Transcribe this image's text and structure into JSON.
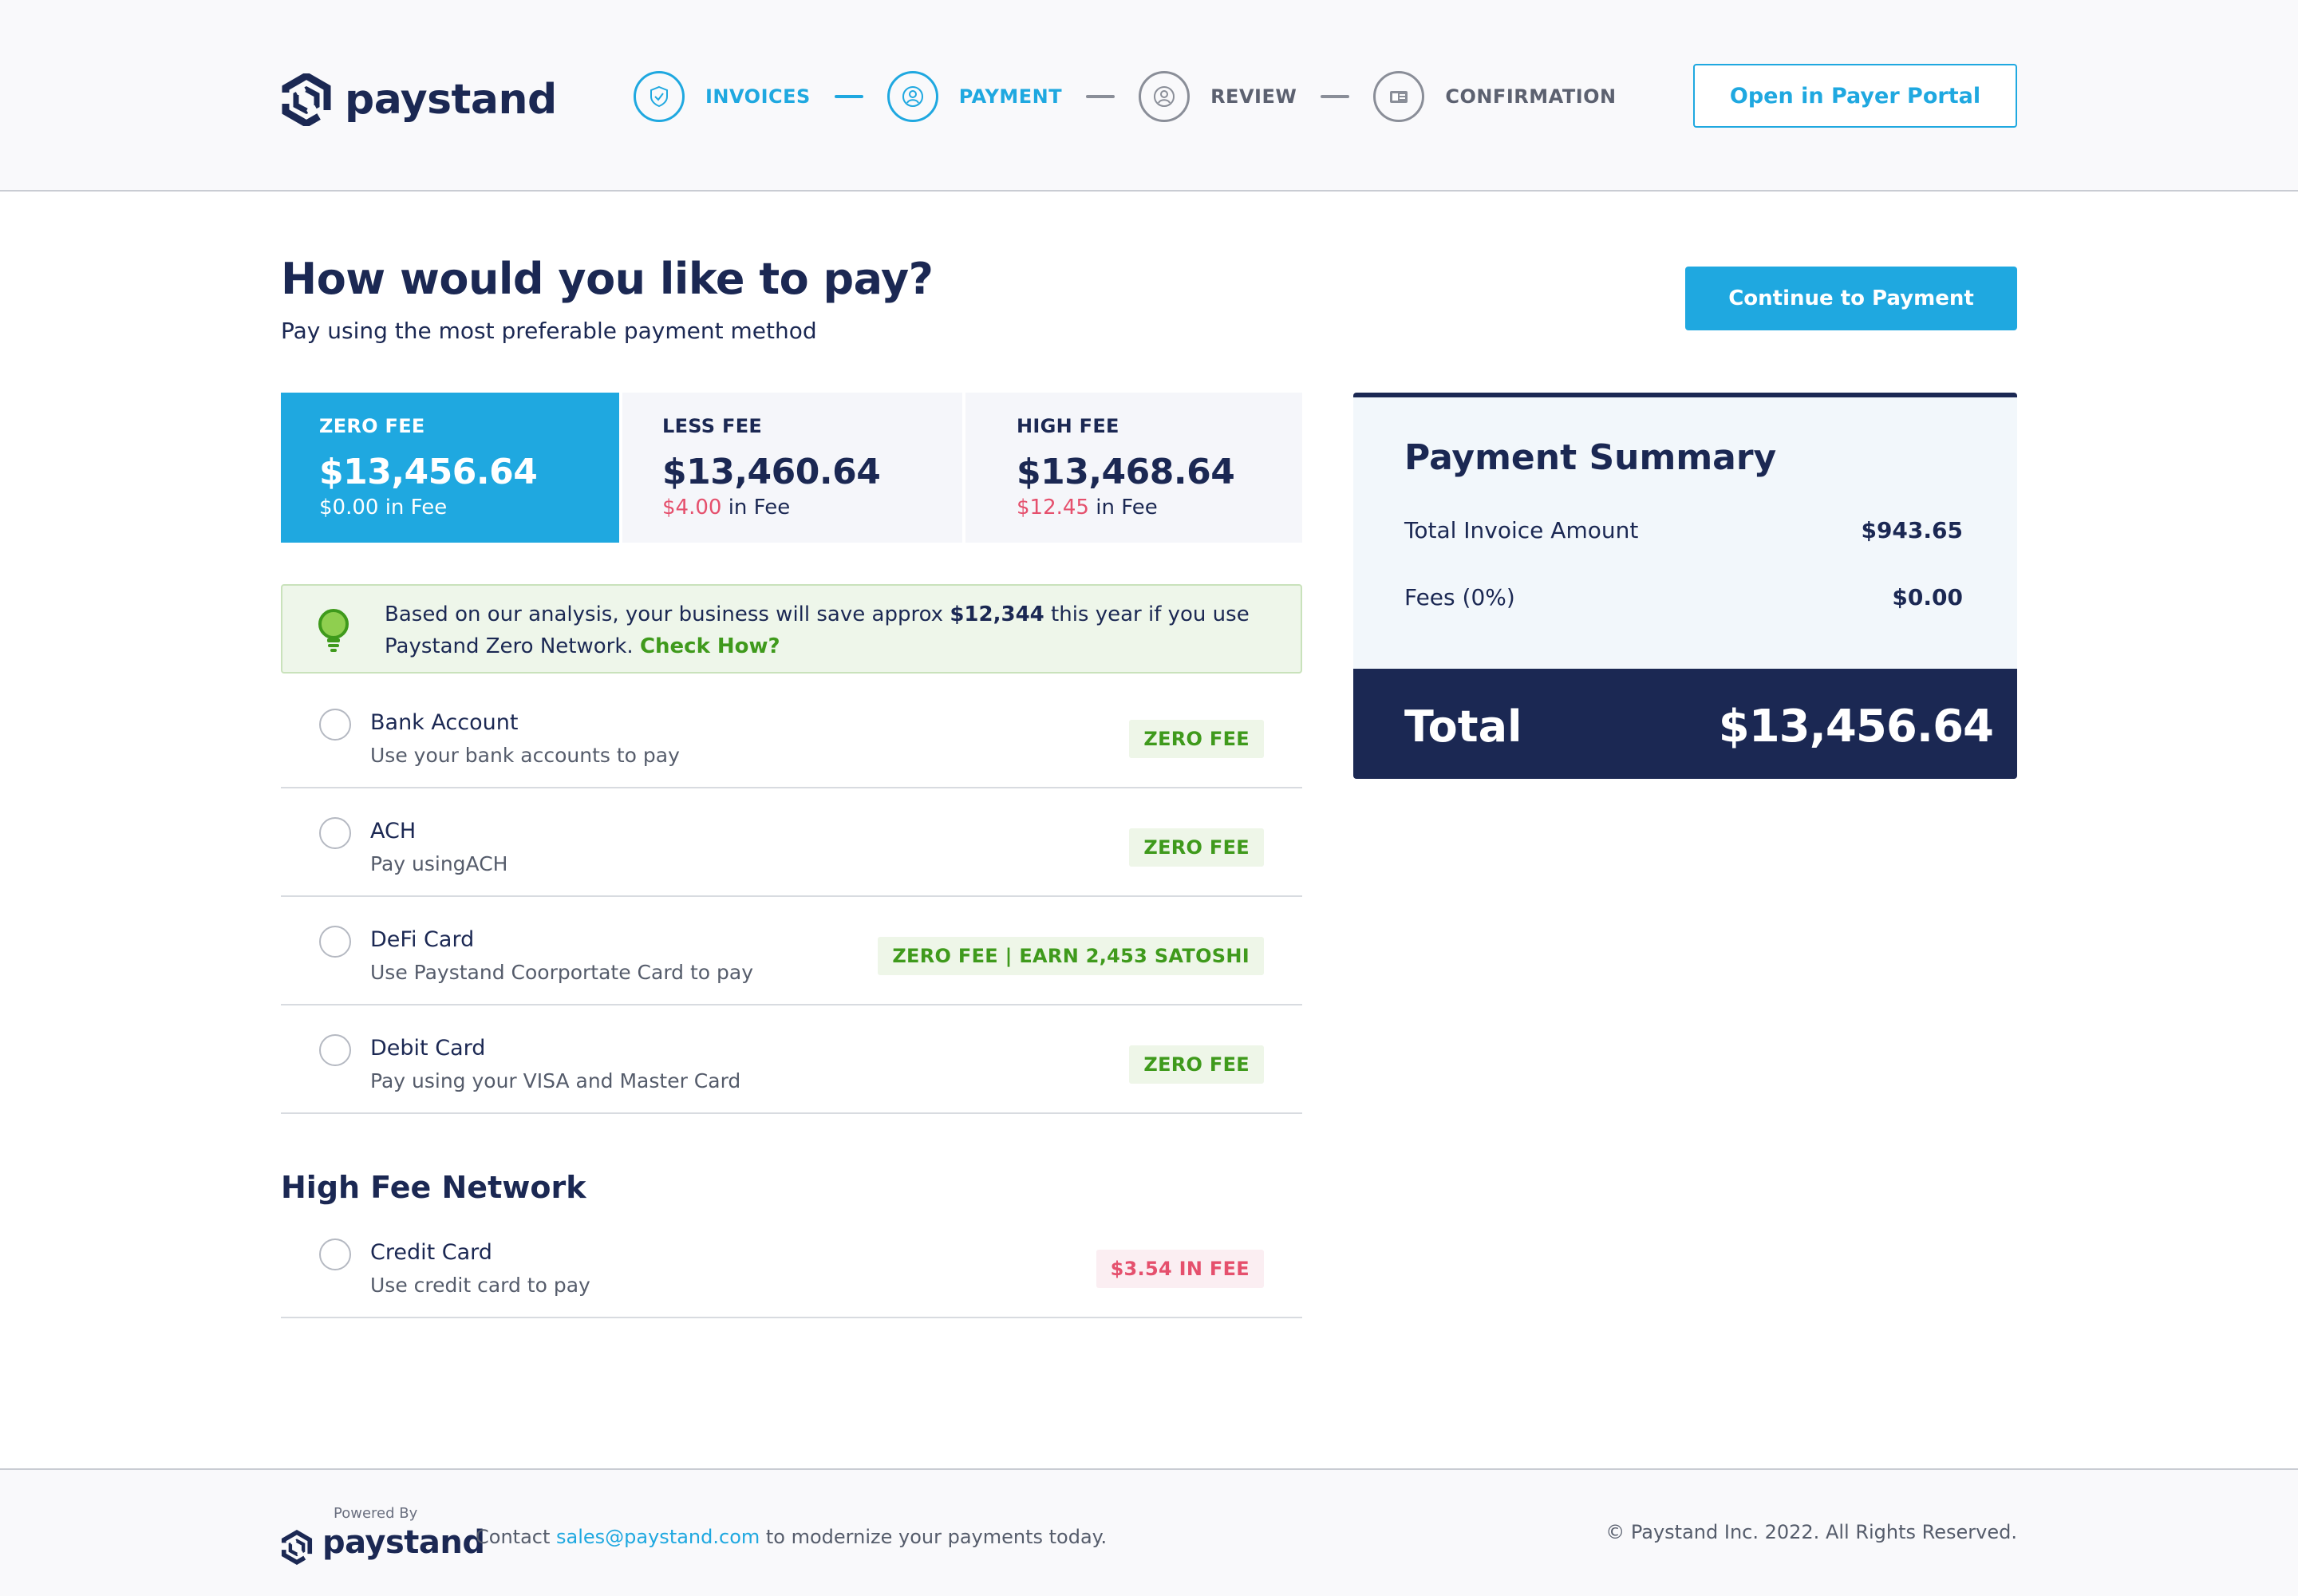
{
  "header": {
    "brand": "paystand",
    "steps": [
      {
        "label": "INVOICES"
      },
      {
        "label": "PAYMENT"
      },
      {
        "label": "REVIEW"
      },
      {
        "label": "CONFIRMATION"
      }
    ],
    "portal_button": "Open in Payer Portal"
  },
  "main": {
    "title": "How would you like to pay?",
    "subtitle": "Pay using the most preferable payment method",
    "continue_button": "Continue to Payment",
    "fee_tabs": [
      {
        "label": "ZERO FEE",
        "amount": "$13,456.64",
        "fee": "$0.00",
        "fee_suffix": " in Fee"
      },
      {
        "label": "LESS FEE",
        "amount": "$13,460.64",
        "fee": "$4.00",
        "fee_suffix": " in Fee"
      },
      {
        "label": "HIGH FEE",
        "amount": "$13,468.64",
        "fee": "$12.45",
        "fee_suffix": " in Fee"
      }
    ],
    "insight": {
      "prefix": "Based on our analysis, your business will save approx ",
      "amount": "$12,344",
      "middle": " this year if you use Paystand Zero Network. ",
      "link": "Check How?"
    },
    "methods": [
      {
        "name": "Bank Account",
        "desc": "Use your bank accounts to pay",
        "badge": "ZERO FEE"
      },
      {
        "name": "ACH",
        "desc": "Pay usingACH",
        "badge": "ZERO FEE"
      },
      {
        "name": "DeFi Card",
        "desc": "Use Paystand Coorportate Card to pay",
        "badge": "ZERO FEE | EARN 2,453 SATOSHI"
      },
      {
        "name": "Debit Card",
        "desc": "Pay using your VISA and Master Card",
        "badge": "ZERO FEE"
      }
    ],
    "high_fee_network": {
      "title": "High Fee Network",
      "methods": [
        {
          "name": "Credit Card",
          "desc": "Use credit card to pay",
          "badge": "$3.54 IN FEE"
        }
      ]
    }
  },
  "summary": {
    "title": "Payment Summary",
    "rows": [
      {
        "label": "Total Invoice Amount",
        "value": "$943.65"
      },
      {
        "label": "Fees (0%)",
        "value": "$0.00"
      }
    ],
    "total_label": "Total",
    "total_value": "$13,456.64"
  },
  "footer": {
    "powered_by": "Powered By",
    "brand": "paystand",
    "contact_prefix": "Contact ",
    "contact_email": "sales@paystand.com",
    "contact_suffix": " to modernize your payments today.",
    "copyright": "© Paystand Inc. 2022. All Rights Reserved."
  },
  "colors": {
    "accent": "#1fa8e0",
    "navy": "#1b2853",
    "green": "#3f9a1c",
    "red": "#e5506d"
  },
  "icons": [
    "paystand-logo-icon",
    "shield-icon",
    "user-icon",
    "user-icon",
    "id-card-icon",
    "lightbulb-icon"
  ]
}
